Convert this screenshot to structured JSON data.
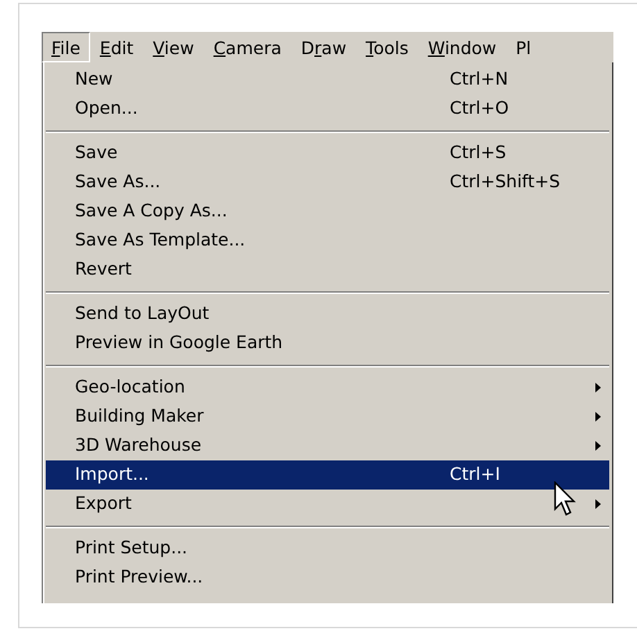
{
  "menu_bar": [
    {
      "key": "F",
      "post": "ile",
      "selected": true
    },
    {
      "key": "E",
      "post": "dit",
      "selected": false
    },
    {
      "key": "V",
      "post": "iew",
      "selected": false
    },
    {
      "key": "C",
      "post": "amera",
      "selected": false
    },
    {
      "pre": "D",
      "key": "r",
      "post": "aw",
      "selected": false
    },
    {
      "key": "T",
      "post": "ools",
      "selected": false
    },
    {
      "key": "W",
      "post": "indow",
      "selected": false
    },
    {
      "pre": "Pl",
      "selected": false
    }
  ],
  "file_menu": [
    {
      "kind": "item",
      "label": "New",
      "shortcut": "Ctrl+N",
      "submenu": false,
      "selected": false
    },
    {
      "kind": "item",
      "label": "Open...",
      "shortcut": "Ctrl+O",
      "submenu": false,
      "selected": false
    },
    {
      "kind": "separator"
    },
    {
      "kind": "item",
      "label": "Save",
      "shortcut": "Ctrl+S",
      "submenu": false,
      "selected": false
    },
    {
      "kind": "item",
      "label": "Save As...",
      "shortcut": "Ctrl+Shift+S",
      "submenu": false,
      "selected": false
    },
    {
      "kind": "item",
      "label": "Save A Copy As...",
      "submenu": false,
      "selected": false
    },
    {
      "kind": "item",
      "label": "Save As Template...",
      "submenu": false,
      "selected": false
    },
    {
      "kind": "item",
      "label": "Revert",
      "submenu": false,
      "selected": false
    },
    {
      "kind": "separator"
    },
    {
      "kind": "item",
      "label": "Send to LayOut",
      "submenu": false,
      "selected": false
    },
    {
      "kind": "item",
      "label": "Preview in Google Earth",
      "submenu": false,
      "selected": false
    },
    {
      "kind": "separator"
    },
    {
      "kind": "item",
      "label": "Geo-location",
      "submenu": true,
      "selected": false
    },
    {
      "kind": "item",
      "label": "Building Maker",
      "submenu": true,
      "selected": false
    },
    {
      "kind": "item",
      "label": "3D Warehouse",
      "submenu": true,
      "selected": false
    },
    {
      "kind": "item",
      "label": "Import...",
      "shortcut": "Ctrl+I",
      "submenu": false,
      "selected": true
    },
    {
      "kind": "item",
      "label": "Export",
      "submenu": true,
      "selected": false
    },
    {
      "kind": "separator"
    },
    {
      "kind": "item",
      "label": "Print Setup...",
      "submenu": false,
      "selected": false
    },
    {
      "kind": "item",
      "label": "Print Preview...",
      "submenu": false,
      "selected": false
    }
  ]
}
